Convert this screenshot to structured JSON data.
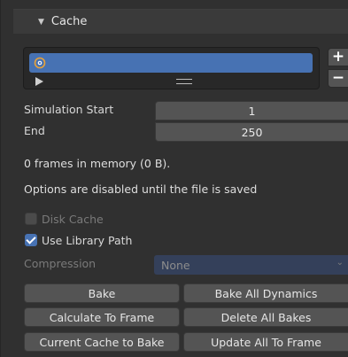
{
  "panel": {
    "title": "Cache",
    "collapse_glyph": "▼"
  },
  "list": {
    "add_label": "+",
    "remove_label": "−"
  },
  "fields": {
    "simulation_start_label": "Simulation Start",
    "simulation_start_value": "1",
    "end_label": "End",
    "end_value": "250"
  },
  "info": {
    "frames_in_memory": "0 frames in memory (0 B).",
    "disabled_notice": "Options are disabled until the file is saved"
  },
  "options": {
    "disk_cache_label": "Disk Cache",
    "disk_cache_checked": false,
    "use_library_path_label": "Use Library Path",
    "use_library_path_checked": true,
    "compression_label": "Compression",
    "compression_value": "None",
    "chevron_glyph": "⌄"
  },
  "buttons": {
    "bake": "Bake",
    "bake_all_dynamics": "Bake All Dynamics",
    "calculate_to_frame": "Calculate To Frame",
    "delete_all_bakes": "Delete All Bakes",
    "current_cache_to_bake": "Current Cache to Bake",
    "update_all_to_frame": "Update All To Frame"
  },
  "colors": {
    "accent": "#4772b3",
    "panel_bg": "#303030",
    "button_bg": "#545454"
  }
}
